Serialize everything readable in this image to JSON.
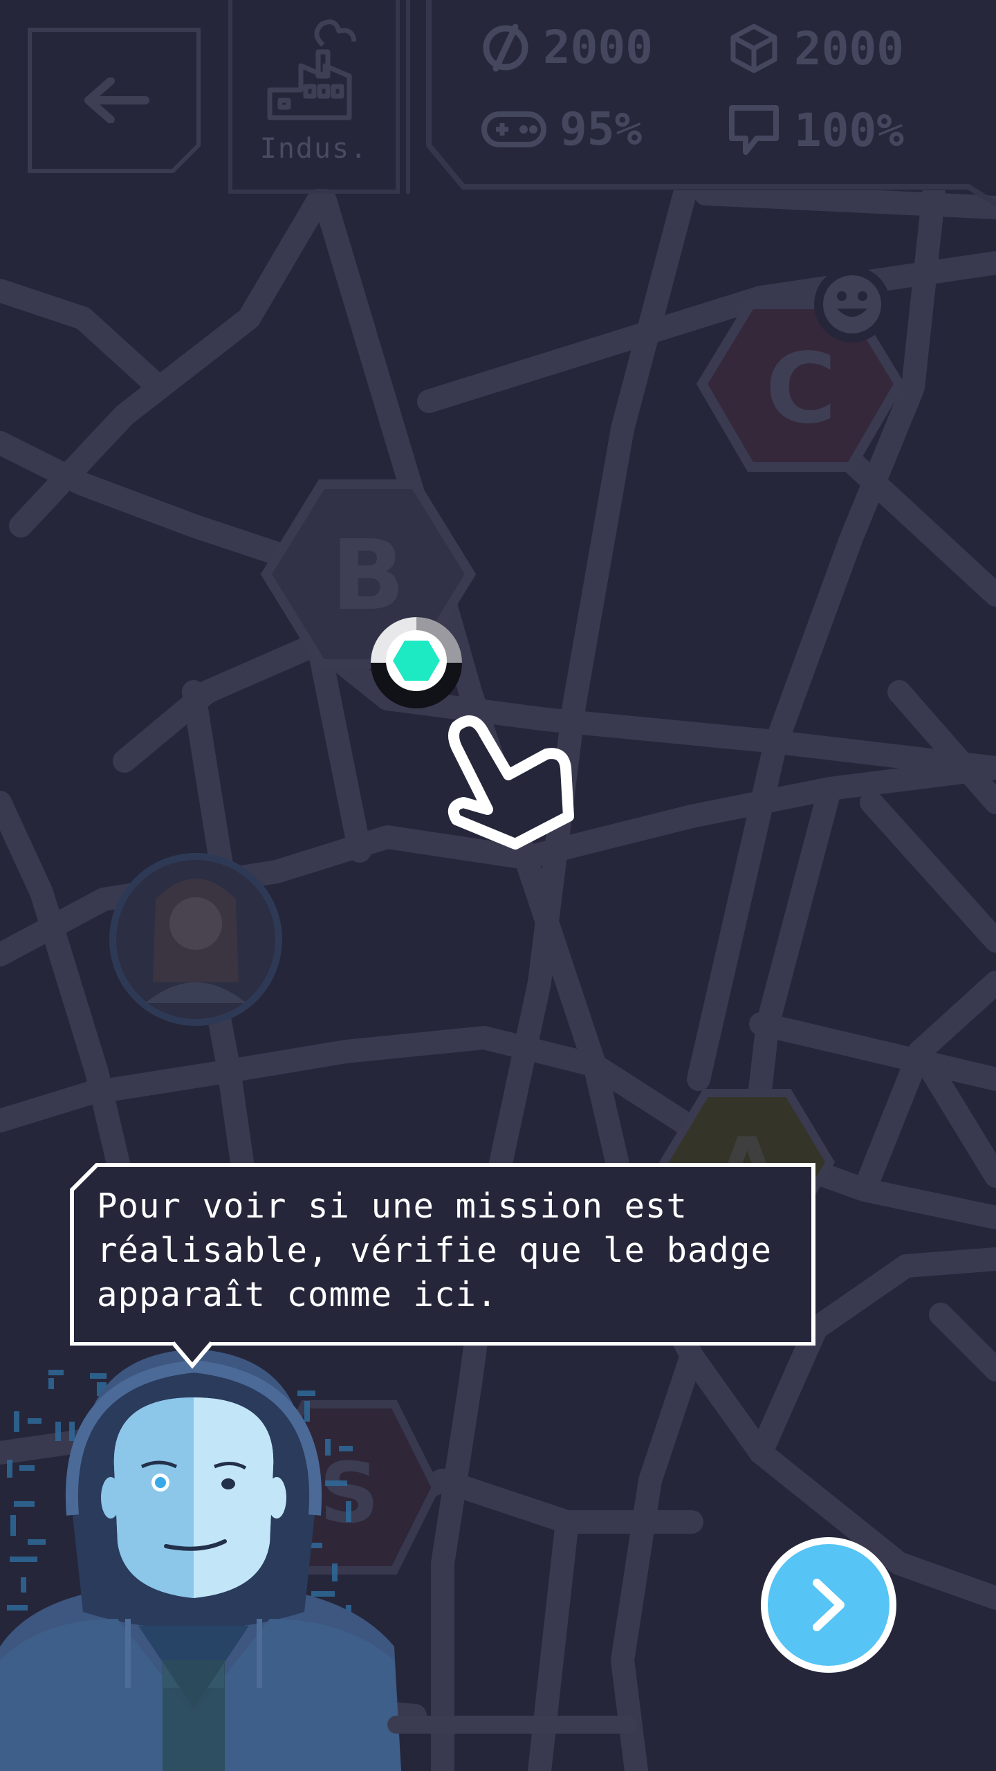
{
  "hud": {
    "back_label": "Retour",
    "sector": {
      "label": "Indus.",
      "icon": "factory-icon"
    },
    "stats": [
      {
        "name": "currency",
        "icon": "currency-icon",
        "value": "2000"
      },
      {
        "name": "resources",
        "icon": "cube-icon",
        "value": "2000"
      },
      {
        "name": "fun",
        "icon": "gamepad-icon",
        "value": "95%"
      },
      {
        "name": "opinion",
        "icon": "chat-icon",
        "value": "100%"
      }
    ]
  },
  "map": {
    "nodes": [
      {
        "name": "node-b",
        "letter": "B"
      },
      {
        "name": "node-c",
        "letter": "C"
      },
      {
        "name": "node-a",
        "letter": "A"
      },
      {
        "name": "node-s",
        "letter": "S"
      }
    ],
    "badge_color": "#1de9c3"
  },
  "tutorial": {
    "message": "Pour voir si une mission est réalisable, vérifie que le badge apparaît comme ici."
  },
  "colors": {
    "background": "#25263a",
    "roads": "#393a50",
    "accent": "#56c4f5",
    "badge": "#1de9c3"
  }
}
